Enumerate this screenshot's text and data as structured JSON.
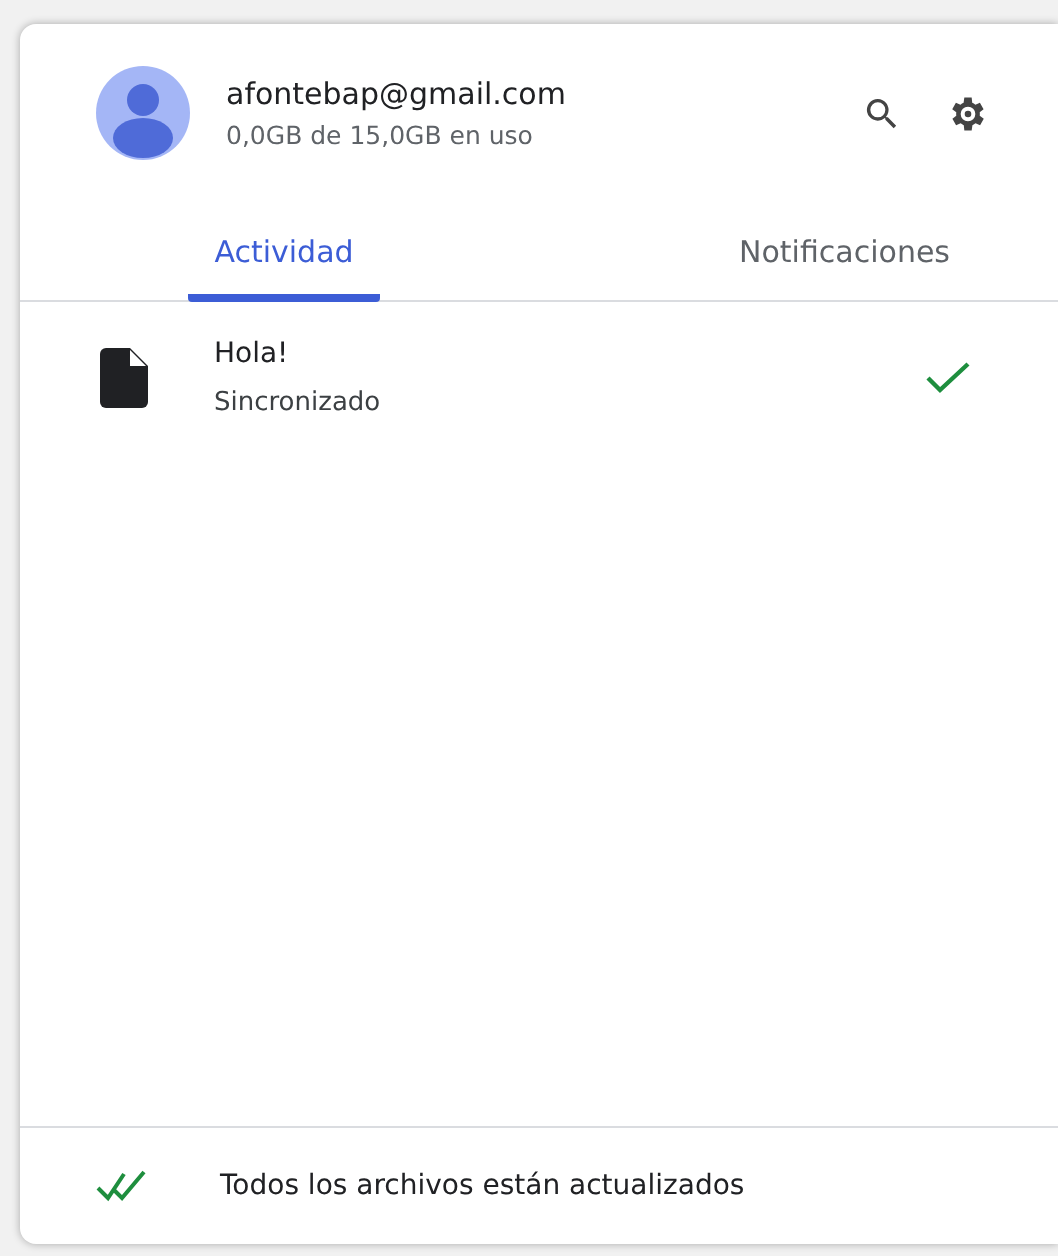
{
  "account": {
    "email": "afontebap@gmail.com",
    "usage": "0,0GB de 15,0GB en uso"
  },
  "tabs": [
    {
      "label": "Actividad",
      "selected": true
    },
    {
      "label": "Notificaciones",
      "selected": false
    }
  ],
  "activity": [
    {
      "name": "Hola!",
      "status": "Sincronizado",
      "synced": true
    }
  ],
  "footer": {
    "message": "Todos los archivos están actualizados"
  }
}
